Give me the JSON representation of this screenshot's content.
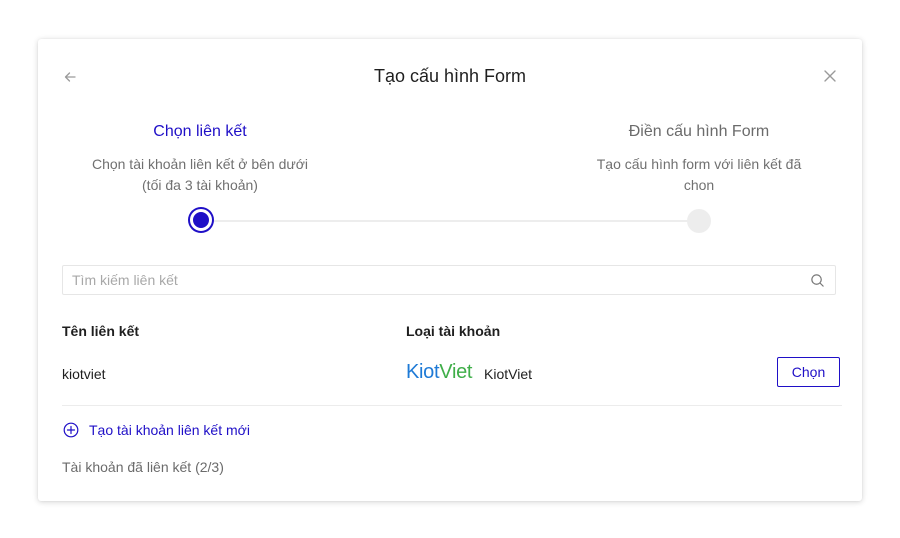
{
  "modal": {
    "title": "Tạo cấu hình Form",
    "back_icon": "arrow-left-icon",
    "close_icon": "close-icon"
  },
  "steps": [
    {
      "title": "Chọn liên kết",
      "description": "Chọn tài khoản liên kết ở bên dưới (tối đa 3 tài khoản)",
      "state": "active"
    },
    {
      "title": "Điền cấu hình Form",
      "description": "Tạo cấu hình form với liên kết đã chon",
      "state": "inactive"
    }
  ],
  "search": {
    "placeholder": "Tìm kiếm liên kết",
    "value": "",
    "icon": "search-icon"
  },
  "table": {
    "headers": [
      "Tên liên kết",
      "Loại tài khoản"
    ],
    "rows": [
      {
        "name": "kiotviet",
        "logo_part1": "Kiot",
        "logo_part2": "Viet",
        "type": "KiotViet",
        "action": "Chọn"
      }
    ]
  },
  "create_link": {
    "label": "Tạo tài khoản liên kết mới",
    "icon": "plus-circle-icon"
  },
  "linked_count": "Tài khoản đã liên kết (2/3)",
  "colors": {
    "accent": "#1f0fc7",
    "kiot_blue": "#1e7ad6",
    "viet_green": "#3fae49",
    "inactive": "#ededed"
  }
}
